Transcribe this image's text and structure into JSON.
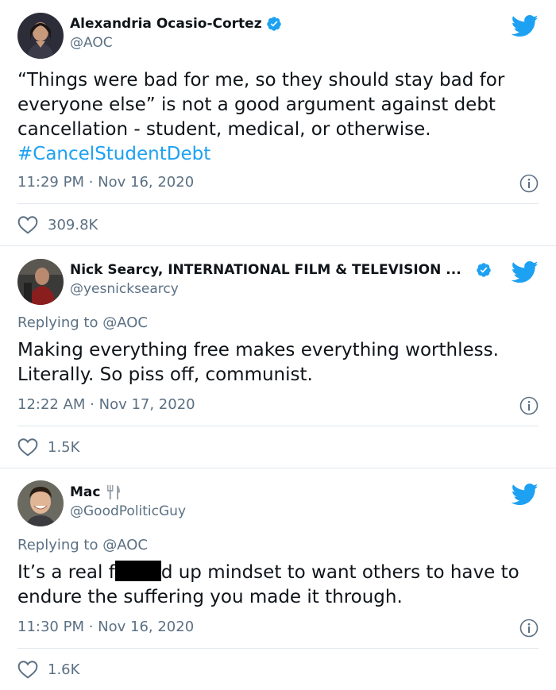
{
  "tweets": [
    {
      "name": "Alexandria Ocasio-Cortez",
      "handle": "@AOC",
      "verified": true,
      "text_main": "“Things were bad for me, so they should stay bad for everyone else” is not a good argument against debt cancellation - student, medical, or otherwise.",
      "hashtag": "#CancelStudentDebt",
      "time": "11:29 PM · Nov 16, 2020",
      "likes": "309.8K"
    },
    {
      "name": "Nick Searcy, INTERNATIONAL FILM & TELEVISION ...",
      "handle": "@yesnicksearcy",
      "verified": true,
      "replying_label": "Replying to",
      "replying_handle": "@AOC",
      "text_main": "Making everything free makes everything worthless. Literally.  So piss off, communist.",
      "time": "12:22 AM · Nov 17, 2020",
      "likes": "1.5K"
    },
    {
      "name": "Mac",
      "handle": "@GoodPoliticGuy",
      "verified": false,
      "replying_label": "Replying to",
      "replying_handle": "@AOC",
      "text_before": "It’s a real f",
      "text_after": "d up mindset to want others to have to endure the suffering you made it through.",
      "time": "11:30 PM · Nov 16, 2020",
      "likes": "1.6K"
    }
  ],
  "colors": {
    "accent": "#1da1f2",
    "muted": "#5b7083",
    "text": "#0f1419",
    "border": "#e1e8ed"
  },
  "icons": [
    "verified-badge-icon",
    "twitter-bird-icon",
    "info-icon",
    "heart-icon",
    "fork-and-knife-icon"
  ]
}
